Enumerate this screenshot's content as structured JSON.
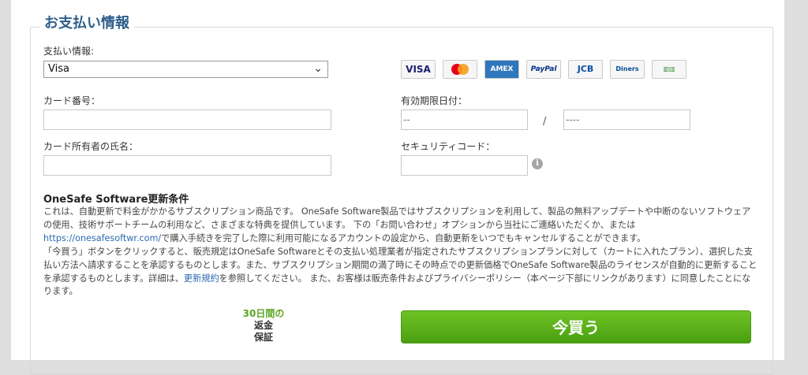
{
  "section": {
    "title": "お支払い情報"
  },
  "payment": {
    "label": "支払い情報:",
    "selected": "Visa",
    "cards": [
      {
        "name": "visa-card-icon",
        "text": "VISA",
        "color": "#1a1f71"
      },
      {
        "name": "mastercard-card-icon",
        "text": "",
        "color": "#eb001b"
      },
      {
        "name": "amex-card-icon",
        "text": "AMEX",
        "color": "#2e77bc"
      },
      {
        "name": "paypal-card-icon",
        "text": "PayPal",
        "color": "#003087"
      },
      {
        "name": "jcb-card-icon",
        "text": "JCB",
        "color": "#0b4ea2"
      },
      {
        "name": "diners-card-icon",
        "text": "Diners",
        "color": "#004a97"
      },
      {
        "name": "boleto-card-icon",
        "text": "Cards",
        "color": "#3a8f3a"
      }
    ]
  },
  "card_number": {
    "label": "カード番号：",
    "value": ""
  },
  "expiry": {
    "label": "有効期限日付：",
    "month": "--",
    "year": "----",
    "separator": "/"
  },
  "holder": {
    "label": "カード所有者の氏名：",
    "value": ""
  },
  "security": {
    "label": "セキュリティコード：",
    "value": ""
  },
  "terms": {
    "title": "OneSafe Software更新条件",
    "p1": "これは、自動更新で料金がかかるサブスクリプション商品です。 OneSafe Software製品ではサブスクリプションを利用して、製品の無料アップデートや中断のないソフトウェアの使用、技術サポートチームの利用など、さまざまな特典を提供しています。 下の「お問い合わせ」オプションから当社にご連絡いただくか、または",
    "link": "https://onesafesoftwr.com/",
    "p1b": "で購入手続きを完了した際に利用可能になるアカウントの設定から、自動更新をいつでもキャンセルすることができます。",
    "p2": "「今買う」ボタンをクリックすると、販売規定はOneSafe Softwareとその支払い処理業者が指定されたサブスクリプションプランに対して（カートに入れたプラン）、選択した支払い方法へ請求することを承認するものとします。また、サブスクリプション期間の満了時にその時点での更新価格でOneSafe Software製品のライセンスが自動的に更新することを承認するものとします。詳細は、",
    "renewal_link": "更新規約",
    "p2b": "を参照してください。 また、お客様は販売条件およびプライバシーポリシー（本ページ下部にリンクがあります）に同意したことになります。"
  },
  "guarantee": {
    "line1": "30日間の",
    "line2": "返金",
    "line3": "保証"
  },
  "buy_button": {
    "label": "今買う"
  }
}
